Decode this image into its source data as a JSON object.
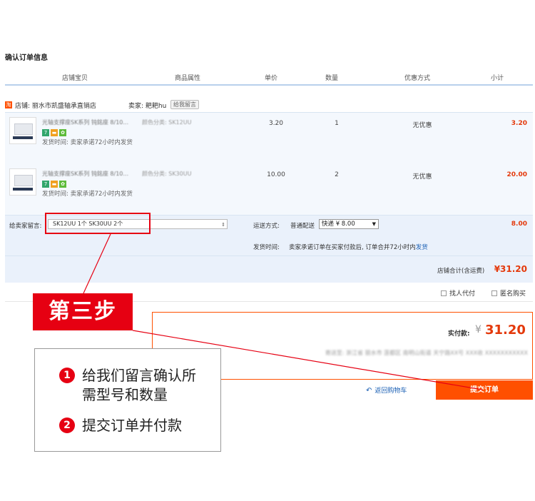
{
  "page": {
    "title": "确认订单信息"
  },
  "table_headers": [
    "店铺宝贝",
    "商品属性",
    "单价",
    "数量",
    "优惠方式",
    "小计"
  ],
  "shop": {
    "logo_text": "淘",
    "name_label": "店铺: 丽水市凯盛轴承直销店",
    "seller_label": "卖家: 耙耙hu",
    "message_link": "给我留言"
  },
  "items": [
    {
      "name": "光轴支撑座SK系列 钝銘座 8/10...",
      "spec": "颜色分类: SK12UU",
      "ship_time": "发货时间: 卖家承诺72小时内发货",
      "price": "3.20",
      "qty": "1",
      "promo": "无优惠",
      "subtotal": "3.20"
    },
    {
      "name": "光轴支撑座SK系列 钝銘座 8/10...",
      "spec": "颜色分类: SK30UU",
      "ship_time": "发货时间: 卖家承诺72小时内发货",
      "price": "10.00",
      "qty": "2",
      "promo": "无优惠",
      "subtotal": "20.00"
    }
  ],
  "message": {
    "label": "给卖家留言:",
    "value": "SK12UU 1个 SK30UU 2个"
  },
  "shipping": {
    "method_label": "运送方式:",
    "normal": "普通配送",
    "selected": "快递 ¥ 8.00",
    "fee": "8.00",
    "time_label": "发货时间:",
    "time_text": "卖家承诺订单在买家付款后, 订单合并72小时内",
    "time_link": "发货"
  },
  "store_total": {
    "label": "店铺合计(含运费)",
    "value": "¥31.20"
  },
  "options": {
    "proxy_pay": "找人代付",
    "anonymous": "匿名购买"
  },
  "payment": {
    "label": "实付款:",
    "yen": "¥",
    "value": "31.20",
    "address": "寄送至: 浙江省 丽水市 莲都区 南明山街道 天宁路XX号 XXX收 XXXXXXXXXXX"
  },
  "back_link": "返回购物车",
  "submit_label": "提交订单",
  "annotation": {
    "step": "第三步",
    "line1_num": "1",
    "line1": "给我们留言确认所需型号和数量",
    "line2_num": "2",
    "line2": "提交订单并付款"
  },
  "colors": {
    "accent": "#ff5000",
    "annotation_red": "#e60012",
    "price_red": "#e4390b",
    "link_blue": "#1a5fb4"
  }
}
